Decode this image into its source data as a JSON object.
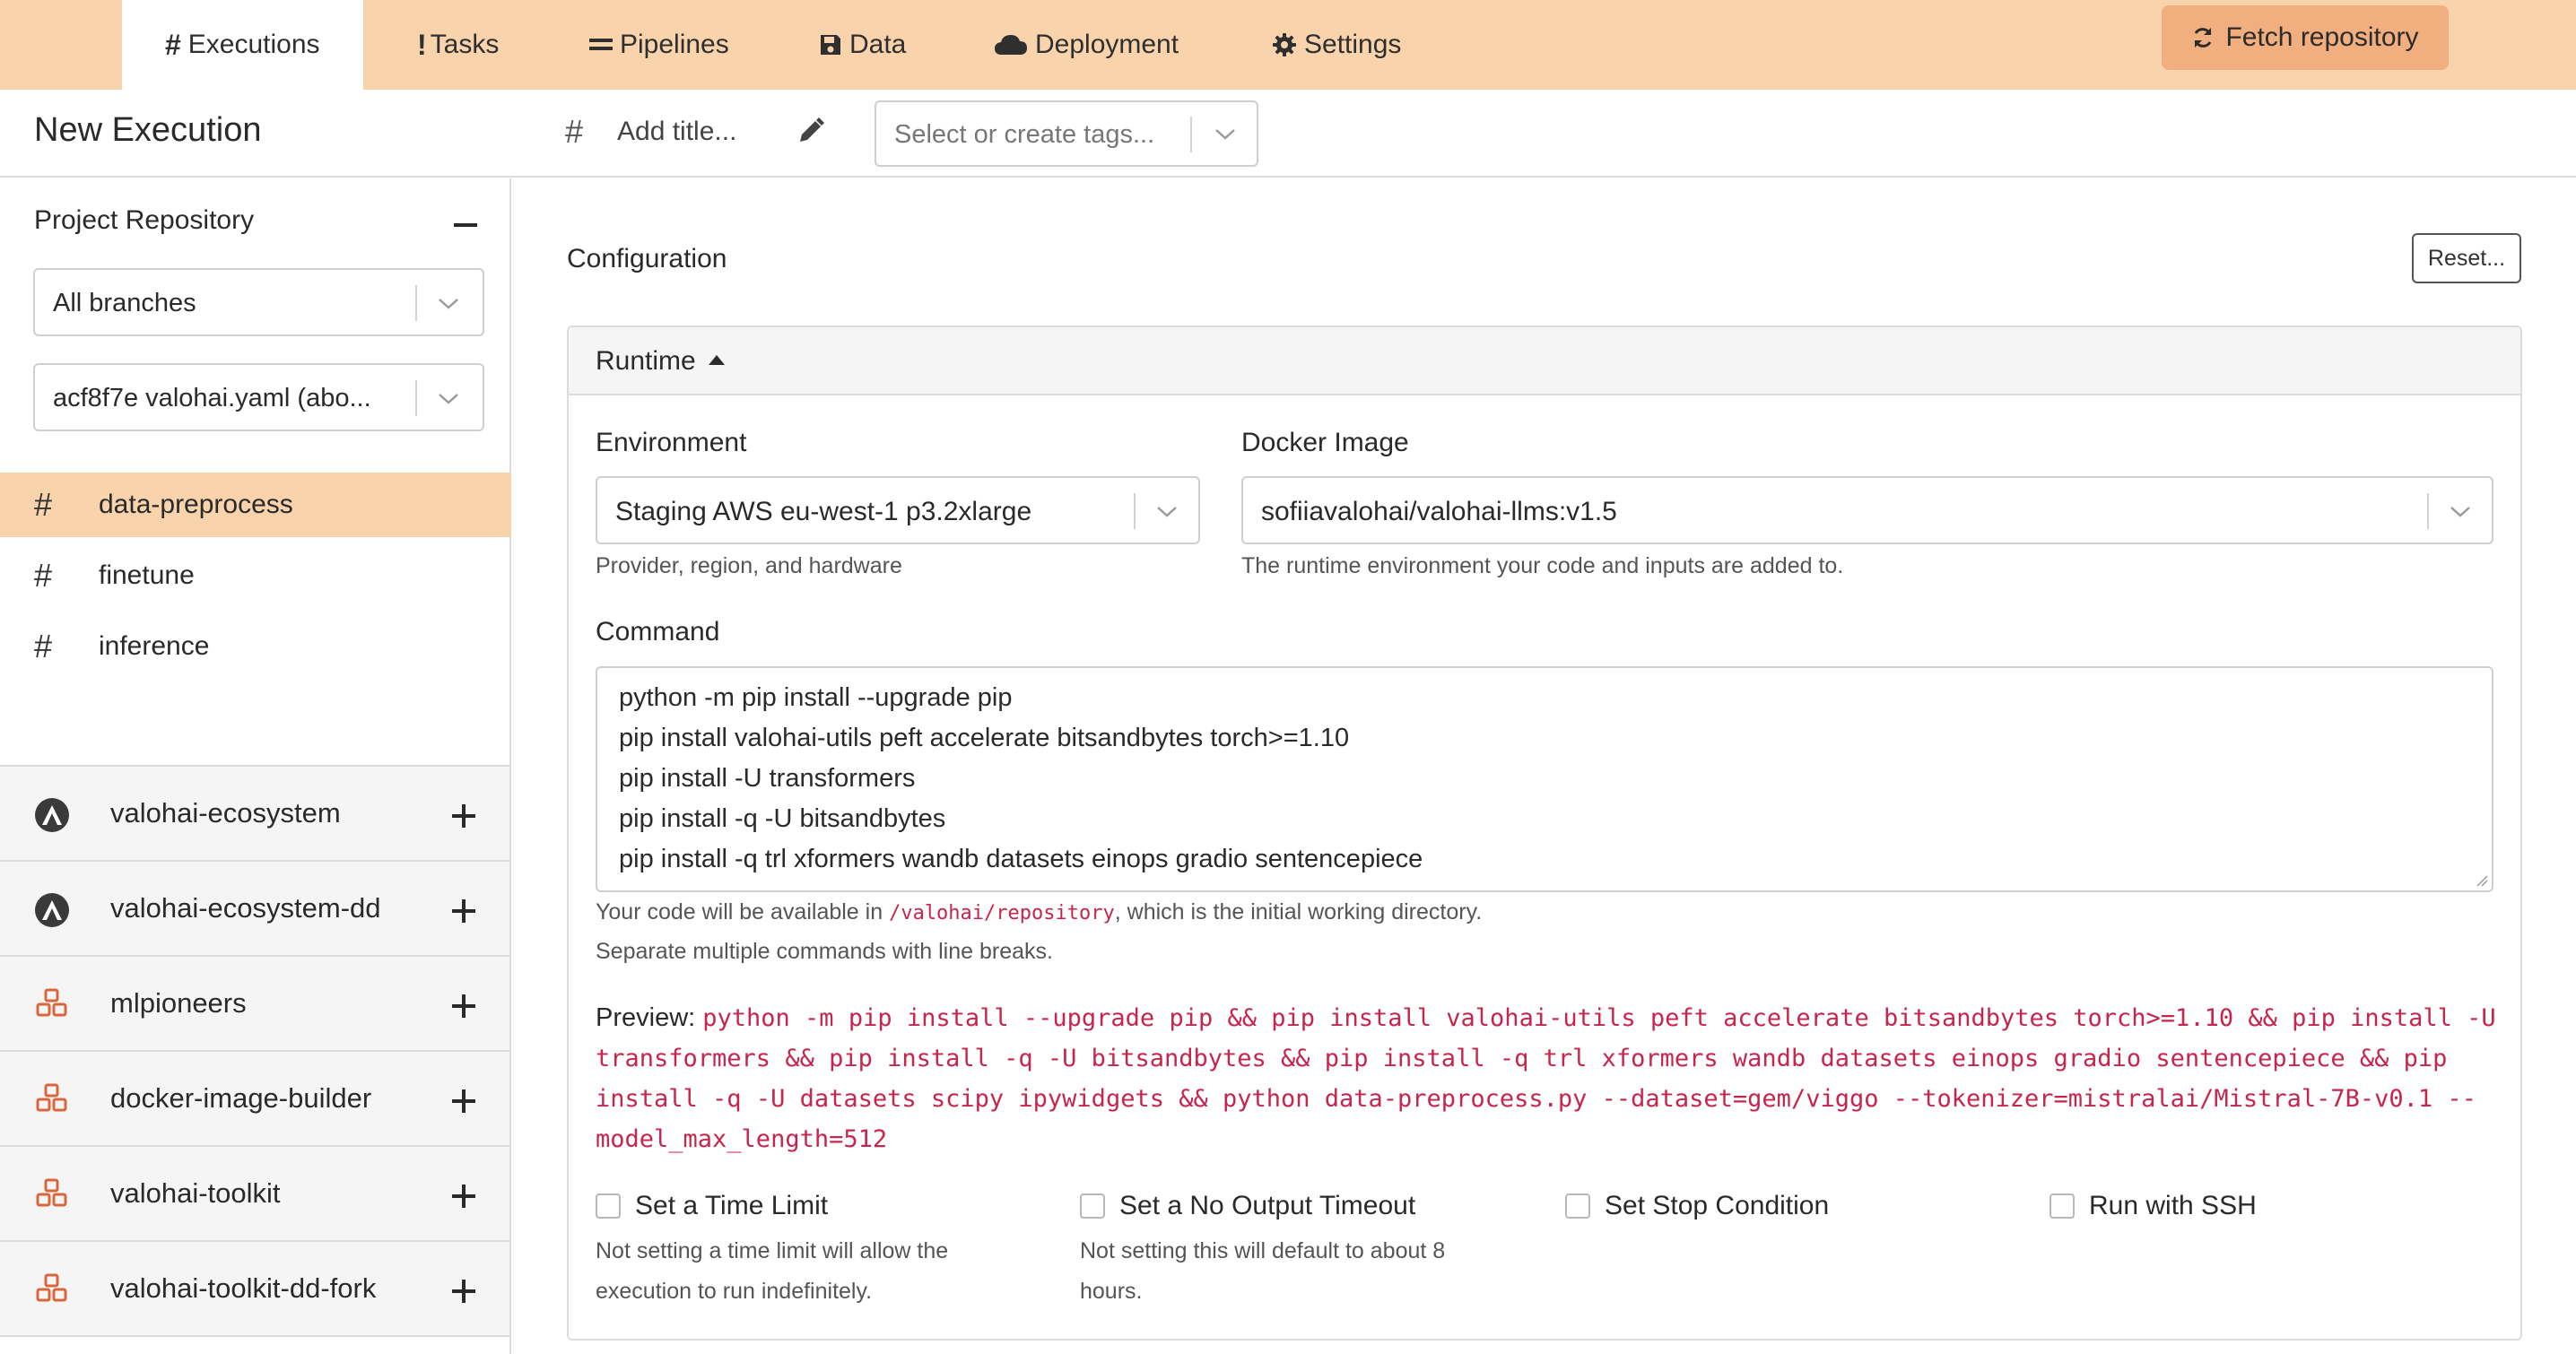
{
  "nav": {
    "tabs": [
      {
        "label": "Executions",
        "icon": "hash-icon"
      },
      {
        "label": "Tasks",
        "icon": "exclamation-icon"
      },
      {
        "label": "Pipelines",
        "icon": "equals-icon"
      },
      {
        "label": "Data",
        "icon": "floppy-disk-icon"
      },
      {
        "label": "Deployment",
        "icon": "cloud-icon"
      },
      {
        "label": "Settings",
        "icon": "gear-icon"
      }
    ],
    "active_tab": "Executions",
    "fetch_label": "Fetch repository"
  },
  "header": {
    "page_title": "New Execution",
    "title_placeholder": "Add title...",
    "tags_placeholder": "Select or create tags..."
  },
  "sidebar": {
    "heading": "Project Repository",
    "branch_select": "All branches",
    "commit_select": "acf8f7e valohai.yaml (abo...",
    "steps": [
      {
        "label": "data-preprocess",
        "active": true
      },
      {
        "label": "finetune",
        "active": false
      },
      {
        "label": "inference",
        "active": false
      }
    ],
    "repos": [
      {
        "label": "valohai-ecosystem",
        "icon": "valohai-logo-icon"
      },
      {
        "label": "valohai-ecosystem-dd",
        "icon": "valohai-logo-icon"
      },
      {
        "label": "mlpioneers",
        "icon": "cubes-icon"
      },
      {
        "label": "docker-image-builder",
        "icon": "cubes-icon"
      },
      {
        "label": "valohai-toolkit",
        "icon": "cubes-icon"
      },
      {
        "label": "valohai-toolkit-dd-fork",
        "icon": "cubes-icon"
      }
    ]
  },
  "main": {
    "title": "Configuration",
    "reset_label": "Reset...",
    "runtime": {
      "section_label": "Runtime",
      "environment_label": "Environment",
      "environment_value": "Staging AWS eu-west-1 p3.2xlarge",
      "environment_help": "Provider, region, and hardware",
      "docker_label": "Docker Image",
      "docker_value": "sofiiavalohai/valohai-llms:v1.5",
      "docker_help": "The runtime environment your code and inputs are added to."
    },
    "command": {
      "label": "Command",
      "lines": [
        "python -m pip install --upgrade pip",
        "pip install valohai-utils peft accelerate bitsandbytes torch>=1.10",
        "pip install -U transformers",
        "pip install -q -U bitsandbytes",
        "pip install -q trl xformers wandb datasets einops gradio sentencepiece"
      ],
      "help_prefix": "Your code will be available in ",
      "help_path": "/valohai/repository",
      "help_suffix": ", which is the initial working directory.",
      "help_line2": "Separate multiple commands with line breaks."
    },
    "preview": {
      "label": "Preview:",
      "code": "python -m pip install --upgrade pip && pip install valohai-utils peft accelerate bitsandbytes torch>=1.10 && pip install -U transformers && pip install -q -U bitsandbytes && pip install -q trl xformers wandb datasets einops gradio sentencepiece && pip install -q -U datasets scipy ipywidgets && python data-preprocess.py --dataset=gem/viggo --tokenizer=mistralai/Mistral-7B-v0.1 --model_max_length=512"
    },
    "options": [
      {
        "label": "Set a Time Limit",
        "checked": false,
        "help": "Not setting a time limit will allow the execution to run indefinitely."
      },
      {
        "label": "Set a No Output Timeout",
        "checked": false,
        "help": "Not setting this will default to about 8 hours."
      },
      {
        "label": "Set Stop Condition",
        "checked": false,
        "help": ""
      },
      {
        "label": "Run with SSH",
        "checked": false,
        "help": ""
      }
    ]
  }
}
